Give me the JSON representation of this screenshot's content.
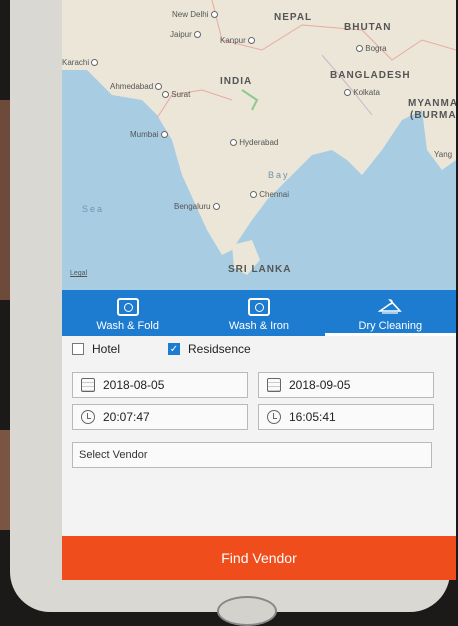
{
  "map": {
    "country_labels": [
      "NEPAL",
      "BHUTAN",
      "INDIA",
      "BANGLADESH",
      "MYANMA",
      "(BURMA",
      "SRI LANKA"
    ],
    "city_labels": [
      "New Delhi",
      "Jaipur",
      "Kanpur",
      "Karachi",
      "Ahmedabad",
      "Surat",
      "Mumbai",
      "Hyderabad",
      "Chennai",
      "Bengaluru",
      "Kolkata",
      "Bogra",
      "Yang"
    ],
    "sea_labels": [
      "Sea",
      "Bay"
    ],
    "legal": "Legal"
  },
  "services": [
    {
      "label": "Wash & Fold",
      "icon": "washing-machine-icon"
    },
    {
      "label": "Wash & Iron",
      "icon": "washer-icon"
    },
    {
      "label": "Dry Cleaning",
      "icon": "hanger-icon"
    }
  ],
  "form": {
    "hotel_label": "Hotel",
    "hotel_checked": false,
    "residence_label": "Residsence",
    "residence_checked": true,
    "start_date": "2018-08-05",
    "end_date": "2018-09-05",
    "start_time": "20:07:47",
    "end_time": "16:05:41",
    "vendor_placeholder": "Select Vendor"
  },
  "find_button": "Find Vendor",
  "colors": {
    "primary": "#1d7ccf",
    "accent": "#f04d1c"
  }
}
